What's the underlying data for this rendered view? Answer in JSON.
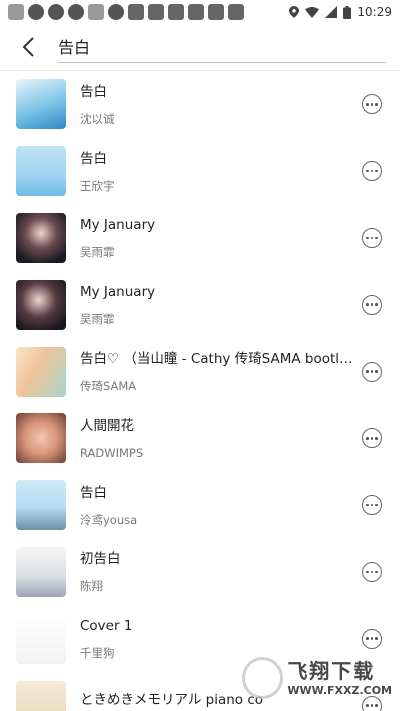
{
  "status_bar": {
    "time": "10:29"
  },
  "search": {
    "query": "告白"
  },
  "results": [
    {
      "title": "告白",
      "artist": "沈以诚"
    },
    {
      "title": "告白",
      "artist": "王欣宇"
    },
    {
      "title": "My January",
      "artist": "吴雨霏"
    },
    {
      "title": "My January",
      "artist": "吴雨霏"
    },
    {
      "title": "告白♡ （当山瞳 - Cathy 传琦SAMA bootleg）",
      "artist": "传琦SAMA"
    },
    {
      "title": "人間開花",
      "artist": "RADWIMPS"
    },
    {
      "title": "告白",
      "artist": "泠鸢yousa"
    },
    {
      "title": "初告白",
      "artist": "陈翔"
    },
    {
      "title": "Cover 1",
      "artist": "千里狗"
    },
    {
      "title": "ときめきメモリアル piano co",
      "artist": ""
    }
  ],
  "watermark": {
    "name": "飞翔下载",
    "url": "WWW.FXXZ.COM"
  }
}
